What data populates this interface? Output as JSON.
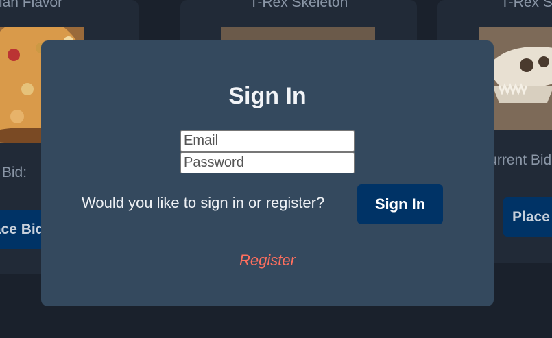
{
  "background_cards": [
    {
      "title": "Italian Flavor",
      "bid_label": "Current Bid:",
      "button_label": "Place Bid"
    },
    {
      "title": "T-Rex Skeleton",
      "bid_label": "",
      "button_label": ""
    },
    {
      "title": "T-Rex Skull",
      "bid_label": "Current Bid:",
      "button_label": "Place Bid"
    }
  ],
  "modal": {
    "title": "Sign In",
    "email_placeholder": "Email",
    "password_placeholder": "Password",
    "question": "Would you like to sign in or register?",
    "signin_label": "Sign In",
    "register_label": "Register"
  },
  "colors": {
    "page_bg": "#1a212c",
    "modal_bg": "#34495e",
    "button_bg": "#003366",
    "register_link": "#ff6f5e"
  }
}
